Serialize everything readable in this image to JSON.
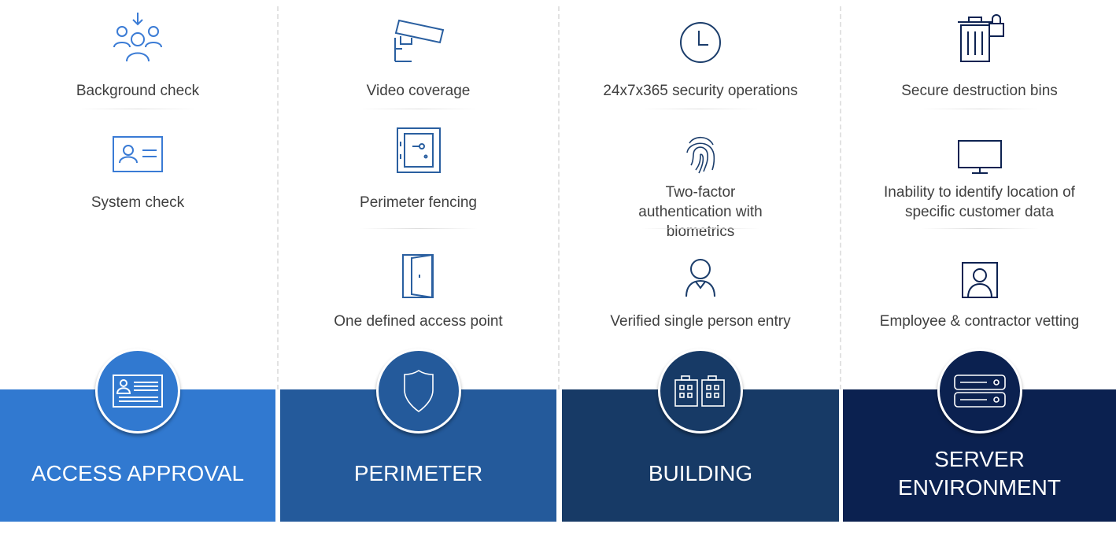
{
  "colors": {
    "access": "#3179d0",
    "perimeter": "#245a9b",
    "building": "#173a66",
    "server": "#0b2150"
  },
  "columns": [
    {
      "title": "ACCESS APPROVAL",
      "icon": "id-card-icon",
      "items": [
        {
          "label": "Background check",
          "icon": "people-arrow-icon"
        },
        {
          "label": "System check",
          "icon": "id-badge-icon"
        }
      ]
    },
    {
      "title": "PERIMETER",
      "icon": "shield-icon",
      "items": [
        {
          "label": "Video coverage",
          "icon": "security-camera-icon"
        },
        {
          "label": "Perimeter fencing",
          "icon": "safe-icon"
        },
        {
          "label": "One defined access point",
          "icon": "door-icon"
        }
      ]
    },
    {
      "title": "BUILDING",
      "icon": "buildings-icon",
      "items": [
        {
          "label": "24x7x365 security operations",
          "icon": "clock-icon"
        },
        {
          "label": "Two-factor authentication with biometrics",
          "icon": "fingerprint-icon"
        },
        {
          "label": "Verified single person entry",
          "icon": "person-icon"
        }
      ]
    },
    {
      "title_line1": "SERVER",
      "title_line2": "ENVIRONMENT",
      "icon": "server-icon",
      "items": [
        {
          "label": "Secure destruction bins",
          "icon": "locked-bin-icon"
        },
        {
          "label": "Inability to identify location of specific customer data",
          "icon": "monitor-icon"
        },
        {
          "label": "Employee & contractor vetting",
          "icon": "person-portrait-icon"
        }
      ]
    }
  ]
}
